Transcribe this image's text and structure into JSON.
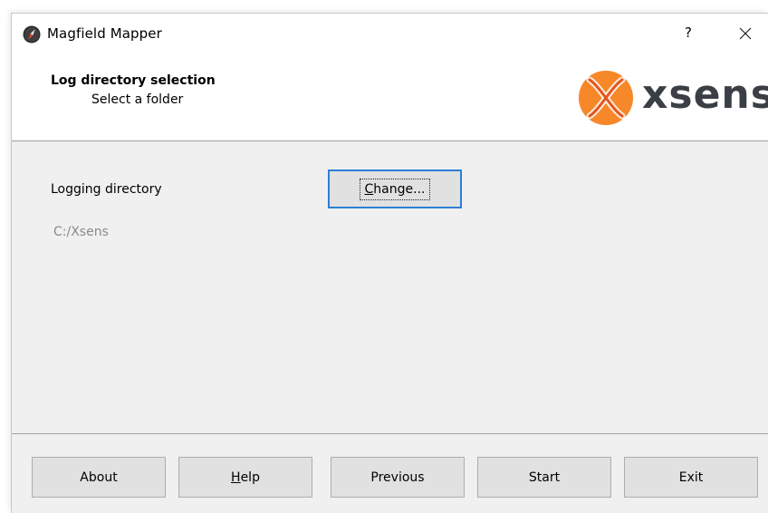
{
  "window": {
    "title": "Magfield Mapper",
    "help_glyph": "?",
    "close_glyph": "✕"
  },
  "header": {
    "title": "Log directory selection",
    "subtitle": "Select a folder",
    "logo_text": "xsens",
    "logo_icon": "xsens-x-logo",
    "brand_color": "#f47b20"
  },
  "content": {
    "logging_label": "Logging directory",
    "change_button": {
      "mnemonic": "C",
      "rest": "hange..."
    },
    "current_path": "C:/Xsens"
  },
  "footer": {
    "about_label": "About",
    "help_button": {
      "mnemonic": "H",
      "rest": "elp"
    },
    "previous_label": "Previous",
    "start_label": "Start",
    "exit_label": "Exit"
  }
}
